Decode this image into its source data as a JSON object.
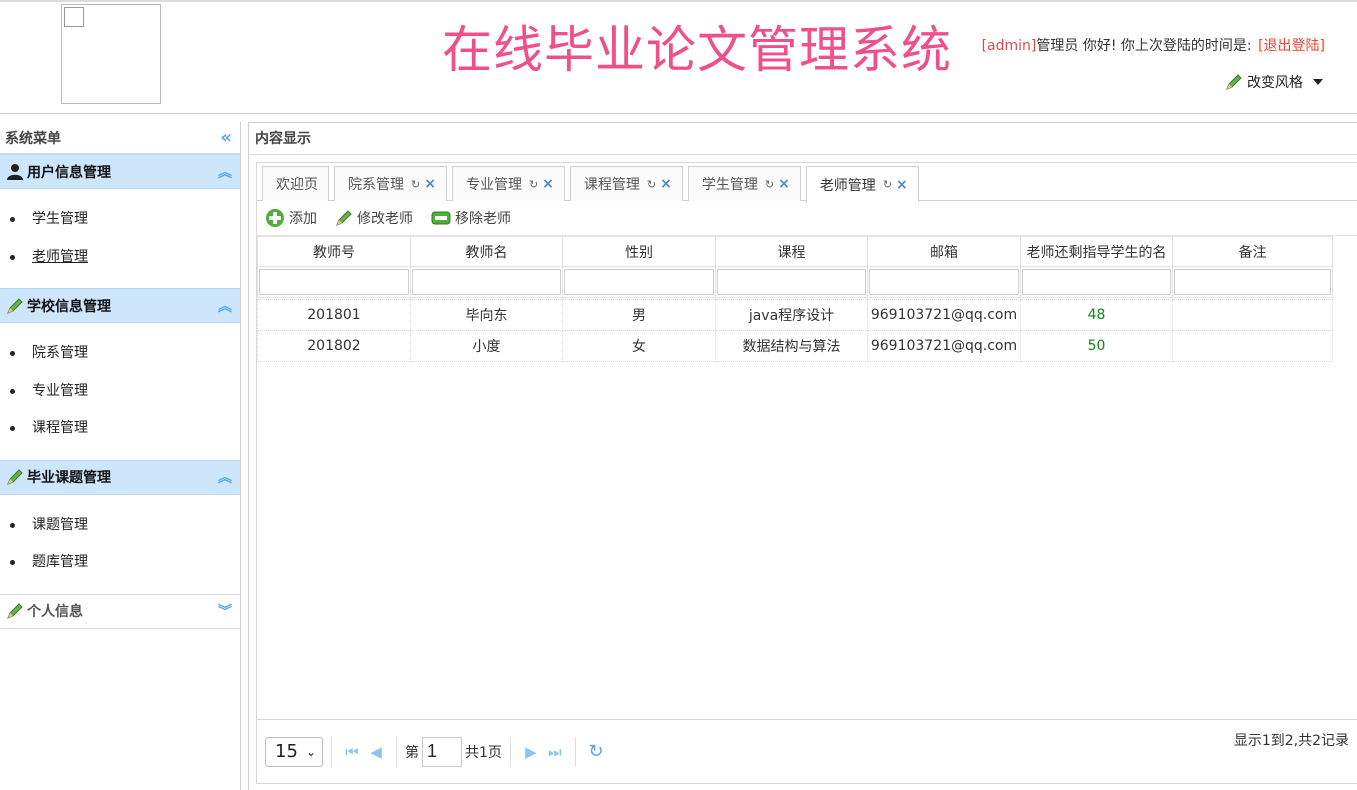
{
  "header": {
    "system_title": "在线毕业论文管理系统",
    "user_name": "[admin]",
    "role_text": "管理员 你好! 你上次登陆的时间是:",
    "logout_label": "[退出登陆]",
    "change_style_label": "改变风格"
  },
  "sidebar": {
    "title": "系统菜单",
    "groups": [
      {
        "title": "用户信息管理",
        "items": [
          "学生管理",
          "老师管理"
        ]
      },
      {
        "title": "学校信息管理",
        "items": [
          "院系管理",
          "专业管理",
          "课程管理"
        ]
      },
      {
        "title": "毕业课题管理",
        "items": [
          "课题管理",
          "题库管理"
        ]
      },
      {
        "title": "个人信息",
        "items": []
      }
    ]
  },
  "content": {
    "title": "内容显示",
    "tabs": [
      "欢迎页",
      "院系管理",
      "专业管理",
      "课程管理",
      "学生管理",
      "老师管理"
    ],
    "active_tab": "老师管理"
  },
  "toolbar": {
    "add_label": "添加",
    "edit_label": "修改老师",
    "remove_label": "移除老师"
  },
  "grid": {
    "columns": [
      "教师号",
      "教师名",
      "性别",
      "课程",
      "邮箱",
      "老师还剩指导学生的名",
      "备注"
    ],
    "rows": [
      [
        "201801",
        "毕向东",
        "男",
        "java程序设计",
        "969103721@qq.com",
        "48",
        ""
      ],
      [
        "201802",
        "小度",
        "女",
        "数据结构与算法",
        "969103721@qq.com",
        "50",
        ""
      ]
    ]
  },
  "pager": {
    "page_size": "15",
    "page_prefix": "第",
    "page_value": "1",
    "page_total": "共1页",
    "summary": "显示1到2,共2记录"
  },
  "colors": {
    "title_pink": "#f0508a",
    "menu_blue": "#cde6fb",
    "accent_blue": "#5aa7e6",
    "number_green": "#118811",
    "logout_red": "#e04b4b"
  }
}
